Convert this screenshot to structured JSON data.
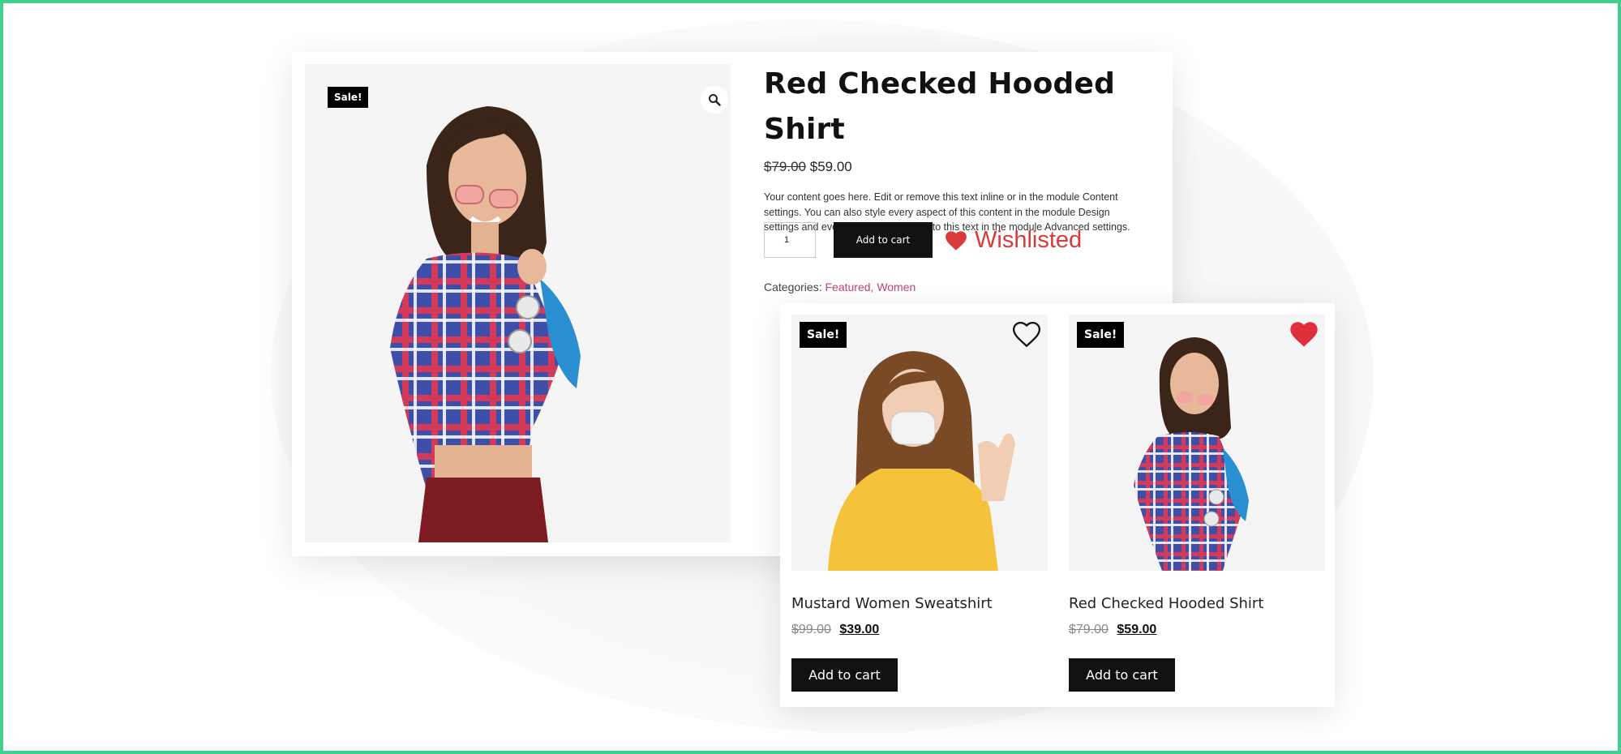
{
  "main_product": {
    "sale_badge": "Sale!",
    "title": "Red Checked Hooded Shirt",
    "old_price": "$79.00",
    "price": "$59.00",
    "description": "Your content goes here. Edit or remove this text inline or in the module Content settings. You can also style every aspect of this content in the module Design settings and even apply custom CSS to this text in the module Advanced settings.",
    "quantity": "1",
    "add_to_cart": "Add to cart",
    "wishlist_label": "Wishlisted",
    "categories_label": "Categories:",
    "categories": [
      "Featured",
      "Women"
    ],
    "zoom_icon": "magnifier-icon"
  },
  "related_products": [
    {
      "sale_badge": "Sale!",
      "title": "Mustard Women Sweatshirt",
      "old_price": "$99.00",
      "price": "$39.00",
      "add_to_cart": "Add to cart",
      "wishlisted": false
    },
    {
      "sale_badge": "Sale!",
      "title": "Red Checked Hooded Shirt",
      "old_price": "$79.00",
      "price": "$59.00",
      "add_to_cart": "Add to cart",
      "wishlisted": true
    }
  ],
  "colors": {
    "frame_border": "#3fcf8e",
    "wishlist_red": "#d93b3b",
    "category_link": "#c2456a",
    "button_dark": "#111111"
  }
}
